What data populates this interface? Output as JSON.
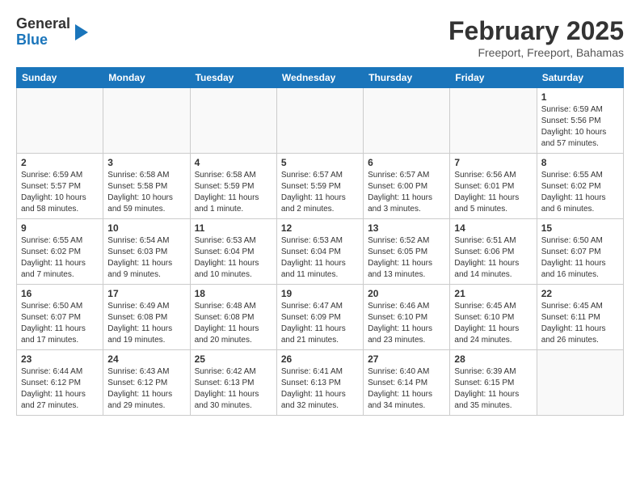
{
  "logo": {
    "general": "General",
    "blue": "Blue"
  },
  "title": "February 2025",
  "location": "Freeport, Freeport, Bahamas",
  "days_of_week": [
    "Sunday",
    "Monday",
    "Tuesday",
    "Wednesday",
    "Thursday",
    "Friday",
    "Saturday"
  ],
  "weeks": [
    [
      {
        "day": "",
        "info": ""
      },
      {
        "day": "",
        "info": ""
      },
      {
        "day": "",
        "info": ""
      },
      {
        "day": "",
        "info": ""
      },
      {
        "day": "",
        "info": ""
      },
      {
        "day": "",
        "info": ""
      },
      {
        "day": "1",
        "info": "Sunrise: 6:59 AM\nSunset: 5:56 PM\nDaylight: 10 hours\nand 57 minutes."
      }
    ],
    [
      {
        "day": "2",
        "info": "Sunrise: 6:59 AM\nSunset: 5:57 PM\nDaylight: 10 hours\nand 58 minutes."
      },
      {
        "day": "3",
        "info": "Sunrise: 6:58 AM\nSunset: 5:58 PM\nDaylight: 10 hours\nand 59 minutes."
      },
      {
        "day": "4",
        "info": "Sunrise: 6:58 AM\nSunset: 5:59 PM\nDaylight: 11 hours\nand 1 minute."
      },
      {
        "day": "5",
        "info": "Sunrise: 6:57 AM\nSunset: 5:59 PM\nDaylight: 11 hours\nand 2 minutes."
      },
      {
        "day": "6",
        "info": "Sunrise: 6:57 AM\nSunset: 6:00 PM\nDaylight: 11 hours\nand 3 minutes."
      },
      {
        "day": "7",
        "info": "Sunrise: 6:56 AM\nSunset: 6:01 PM\nDaylight: 11 hours\nand 5 minutes."
      },
      {
        "day": "8",
        "info": "Sunrise: 6:55 AM\nSunset: 6:02 PM\nDaylight: 11 hours\nand 6 minutes."
      }
    ],
    [
      {
        "day": "9",
        "info": "Sunrise: 6:55 AM\nSunset: 6:02 PM\nDaylight: 11 hours\nand 7 minutes."
      },
      {
        "day": "10",
        "info": "Sunrise: 6:54 AM\nSunset: 6:03 PM\nDaylight: 11 hours\nand 9 minutes."
      },
      {
        "day": "11",
        "info": "Sunrise: 6:53 AM\nSunset: 6:04 PM\nDaylight: 11 hours\nand 10 minutes."
      },
      {
        "day": "12",
        "info": "Sunrise: 6:53 AM\nSunset: 6:04 PM\nDaylight: 11 hours\nand 11 minutes."
      },
      {
        "day": "13",
        "info": "Sunrise: 6:52 AM\nSunset: 6:05 PM\nDaylight: 11 hours\nand 13 minutes."
      },
      {
        "day": "14",
        "info": "Sunrise: 6:51 AM\nSunset: 6:06 PM\nDaylight: 11 hours\nand 14 minutes."
      },
      {
        "day": "15",
        "info": "Sunrise: 6:50 AM\nSunset: 6:07 PM\nDaylight: 11 hours\nand 16 minutes."
      }
    ],
    [
      {
        "day": "16",
        "info": "Sunrise: 6:50 AM\nSunset: 6:07 PM\nDaylight: 11 hours\nand 17 minutes."
      },
      {
        "day": "17",
        "info": "Sunrise: 6:49 AM\nSunset: 6:08 PM\nDaylight: 11 hours\nand 19 minutes."
      },
      {
        "day": "18",
        "info": "Sunrise: 6:48 AM\nSunset: 6:08 PM\nDaylight: 11 hours\nand 20 minutes."
      },
      {
        "day": "19",
        "info": "Sunrise: 6:47 AM\nSunset: 6:09 PM\nDaylight: 11 hours\nand 21 minutes."
      },
      {
        "day": "20",
        "info": "Sunrise: 6:46 AM\nSunset: 6:10 PM\nDaylight: 11 hours\nand 23 minutes."
      },
      {
        "day": "21",
        "info": "Sunrise: 6:45 AM\nSunset: 6:10 PM\nDaylight: 11 hours\nand 24 minutes."
      },
      {
        "day": "22",
        "info": "Sunrise: 6:45 AM\nSunset: 6:11 PM\nDaylight: 11 hours\nand 26 minutes."
      }
    ],
    [
      {
        "day": "23",
        "info": "Sunrise: 6:44 AM\nSunset: 6:12 PM\nDaylight: 11 hours\nand 27 minutes."
      },
      {
        "day": "24",
        "info": "Sunrise: 6:43 AM\nSunset: 6:12 PM\nDaylight: 11 hours\nand 29 minutes."
      },
      {
        "day": "25",
        "info": "Sunrise: 6:42 AM\nSunset: 6:13 PM\nDaylight: 11 hours\nand 30 minutes."
      },
      {
        "day": "26",
        "info": "Sunrise: 6:41 AM\nSunset: 6:13 PM\nDaylight: 11 hours\nand 32 minutes."
      },
      {
        "day": "27",
        "info": "Sunrise: 6:40 AM\nSunset: 6:14 PM\nDaylight: 11 hours\nand 34 minutes."
      },
      {
        "day": "28",
        "info": "Sunrise: 6:39 AM\nSunset: 6:15 PM\nDaylight: 11 hours\nand 35 minutes."
      },
      {
        "day": "",
        "info": ""
      }
    ]
  ]
}
